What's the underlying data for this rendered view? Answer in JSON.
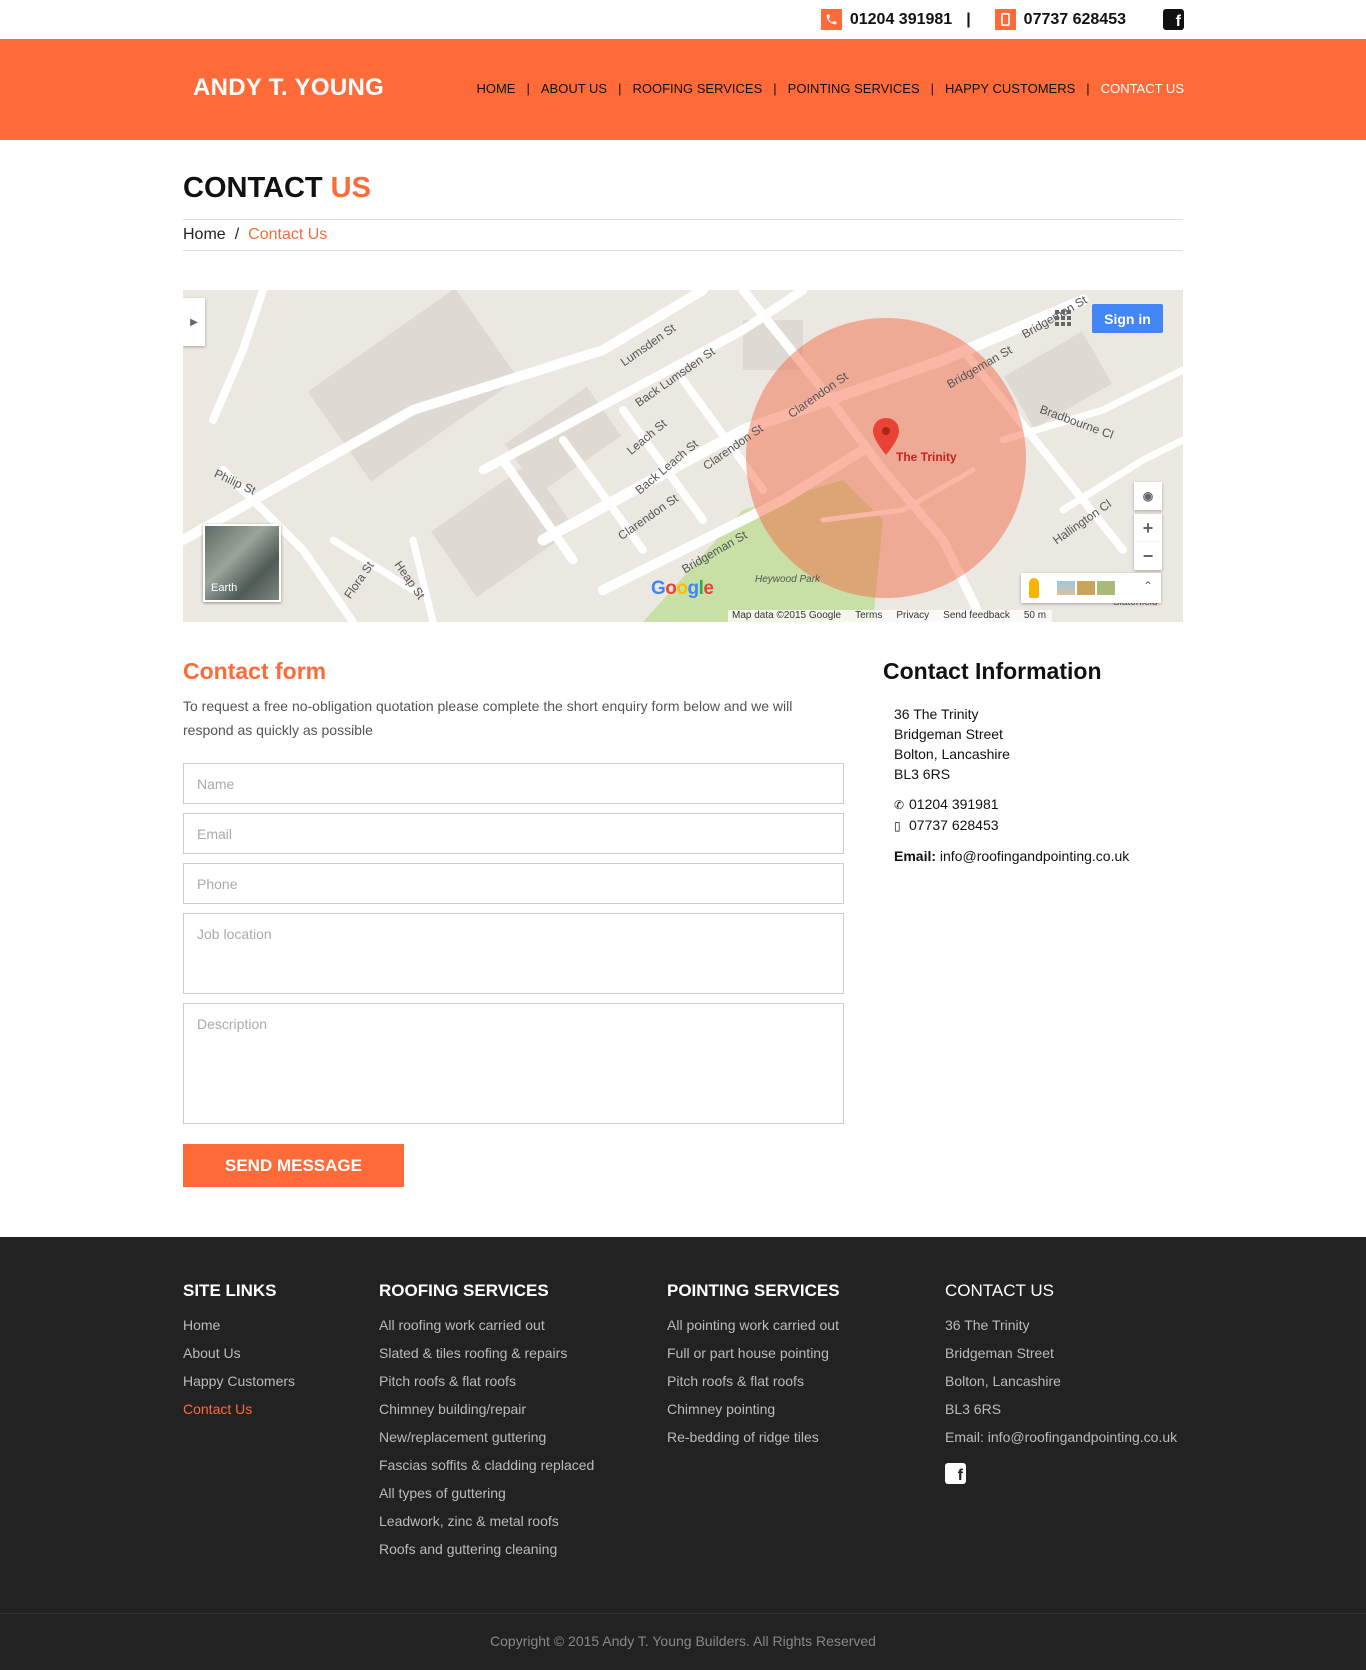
{
  "topbar": {
    "phone_landline": "01204 391981",
    "separator": "|",
    "phone_mobile": "07737 628453",
    "phone_icon": "phone-icon",
    "mobile_icon": "mobile-icon",
    "facebook_icon": "facebook-icon"
  },
  "header": {
    "logo": "ANDY T. YOUNG",
    "nav": [
      {
        "label": "HOME"
      },
      {
        "label": "ABOUT US"
      },
      {
        "label": "ROOFING SERVICES"
      },
      {
        "label": "POINTING SERVICES"
      },
      {
        "label": "HAPPY CUSTOMERS"
      },
      {
        "label": "CONTACT US",
        "active": true
      }
    ],
    "nav_separator": "|"
  },
  "page": {
    "title_main": "CONTACT",
    "title_accent": "US",
    "breadcrumb": {
      "home": "Home",
      "separator": "/",
      "current": "Contact Us"
    }
  },
  "map": {
    "sign_in": "Sign in",
    "earth_label": "Earth",
    "place_label": "The Trinity",
    "park_label": "Heywood Park",
    "zoom_in": "+",
    "zoom_out": "−",
    "google_logo": "Google",
    "attribution": [
      "Map data ©2015 Google",
      "Terms",
      "Privacy",
      "Send feedback",
      "50 m"
    ],
    "streets": [
      "Lumsden St",
      "Back Lumsden St",
      "Leach St",
      "Back Leach St",
      "Clarendon St",
      "Clarendon St",
      "Clarendon St",
      "Bridgeman St",
      "Bridgeman St",
      "Bridgeman St",
      "Bradbourne Cl",
      "Hallington Cl",
      "Philip St",
      "Flora St",
      "Heap St",
      "Slaterfield"
    ]
  },
  "form": {
    "title": "Contact form",
    "intro": "To request a free no-obligation quotation please complete the short enquiry form below and we will respond as quickly as possible",
    "name_placeholder": "Name",
    "email_placeholder": "Email",
    "phone_placeholder": "Phone",
    "job_location_placeholder": "Job location",
    "description_placeholder": "Description",
    "submit": "SEND MESSAGE"
  },
  "contact_info": {
    "title": "Contact Information",
    "address": [
      "36 The Trinity",
      "Bridgeman Street",
      "Bolton, Lancashire",
      "BL3 6RS"
    ],
    "phone": "01204 391981",
    "mobile": "07737 628453",
    "email_label": "Email:",
    "email": "info@roofingandpointing.co.uk"
  },
  "footer": {
    "site_links": {
      "title": "SITE LINKS",
      "items": [
        "Home",
        "About Us",
        "Happy Customers",
        "Contact Us"
      ]
    },
    "roofing": {
      "title": "ROOFING SERVICES",
      "items": [
        "All roofing work carried out",
        "Slated & tiles roofing & repairs",
        "Pitch roofs & flat roofs",
        "Chimney building/repair",
        "New/replacement guttering",
        "Fascias soffits & cladding replaced",
        "All types of guttering",
        "Leadwork, zinc & metal roofs",
        "Roofs and guttering cleaning"
      ]
    },
    "pointing": {
      "title": "POINTING SERVICES",
      "items": [
        "All pointing work carried out",
        "Full or part house pointing",
        "Pitch roofs & flat roofs",
        "Chimney pointing",
        "Re-bedding of ridge tiles"
      ]
    },
    "contact": {
      "title": "CONTACT US",
      "items": [
        "36 The Trinity",
        "Bridgeman Street",
        "Bolton, Lancashire",
        "BL3 6RS",
        "Email: info@roofingandpointing.co.uk"
      ]
    },
    "copyright": "Copyright © 2015 Andy T. Young Builders. All Rights Reserved"
  },
  "colors": {
    "accent": "#ff6a39",
    "footer_bg": "#222222",
    "map_bg": "#ebe8e2",
    "sign_in": "#4285f4"
  }
}
